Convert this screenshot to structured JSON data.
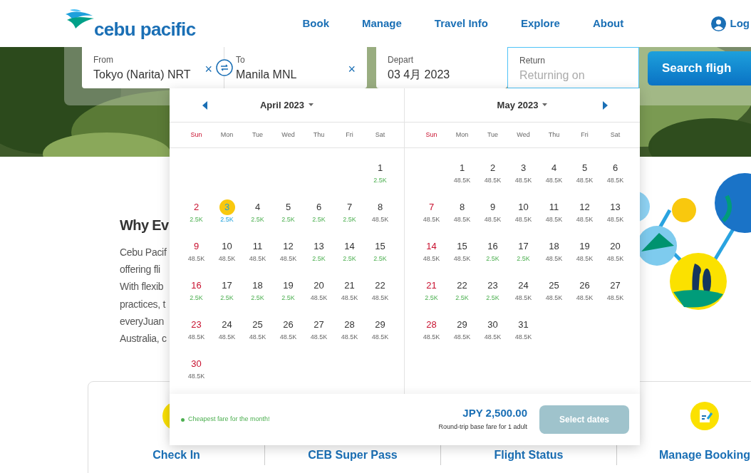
{
  "header": {
    "logo": "cebu pacific",
    "nav": [
      "Book",
      "Manage",
      "Travel Info",
      "Explore",
      "About"
    ],
    "login": "Log"
  },
  "search": {
    "from": {
      "label": "From",
      "value": "Tokyo (Narita) NRT",
      "clear": "×"
    },
    "to": {
      "label": "To",
      "value": "Manila MNL",
      "clear": "×"
    },
    "depart": {
      "label": "Depart",
      "value": "03 4月 2023"
    },
    "return": {
      "label": "Return",
      "placeholder": "Returning on"
    },
    "button": "Search fligh"
  },
  "why": {
    "heading": "Why Ev",
    "lines": [
      "Cebu Pacif",
      "offering fli",
      "With flexib",
      "practices, t",
      "everyJuan",
      "Australia, c"
    ]
  },
  "calendar": {
    "months": [
      {
        "title": "April 2023",
        "prev_arrow": true,
        "next_arrow": false,
        "weekdays": [
          "Sun",
          "Mon",
          "Tue",
          "Wed",
          "Thu",
          "Fri",
          "Sat"
        ],
        "days": [
          {
            "kind": "blank"
          },
          {
            "kind": "blank"
          },
          {
            "kind": "blank"
          },
          {
            "kind": "blank"
          },
          {
            "kind": "blank"
          },
          {
            "kind": "blank"
          },
          {
            "kind": "day",
            "day": "1",
            "fare": "2.5K",
            "cheapest": true,
            "selected": false
          },
          {
            "kind": "day",
            "day": "2",
            "fare": "2.5K",
            "cheapest": true,
            "selected": false
          },
          {
            "kind": "day",
            "day": "3",
            "fare": "2.5K",
            "selected": true
          },
          {
            "kind": "day",
            "day": "4",
            "fare": "2.5K",
            "cheapest": true,
            "selected": false
          },
          {
            "kind": "day",
            "day": "5",
            "fare": "2.5K",
            "cheapest": true,
            "selected": false
          },
          {
            "kind": "day",
            "day": "6",
            "fare": "2.5K",
            "cheapest": true,
            "selected": false
          },
          {
            "kind": "day",
            "day": "7",
            "fare": "2.5K",
            "cheapest": true,
            "selected": false
          },
          {
            "kind": "day",
            "day": "8",
            "fare": "48.5K",
            "cheapest": false,
            "selected": false
          },
          {
            "kind": "day",
            "day": "9",
            "fare": "48.5K",
            "cheapest": false,
            "selected": false
          },
          {
            "kind": "day",
            "day": "10",
            "fare": "48.5K",
            "cheapest": false,
            "selected": false
          },
          {
            "kind": "day",
            "day": "11",
            "fare": "48.5K",
            "cheapest": false,
            "selected": false
          },
          {
            "kind": "day",
            "day": "12",
            "fare": "48.5K",
            "cheapest": false,
            "selected": false
          },
          {
            "kind": "day",
            "day": "13",
            "fare": "2.5K",
            "cheapest": true,
            "selected": false
          },
          {
            "kind": "day",
            "day": "14",
            "fare": "2.5K",
            "cheapest": true,
            "selected": false
          },
          {
            "kind": "day",
            "day": "15",
            "fare": "2.5K",
            "cheapest": true,
            "selected": false
          },
          {
            "kind": "day",
            "day": "16",
            "fare": "2.5K",
            "cheapest": true,
            "selected": false
          },
          {
            "kind": "day",
            "day": "17",
            "fare": "2.5K",
            "cheapest": true,
            "selected": false
          },
          {
            "kind": "day",
            "day": "18",
            "fare": "2.5K",
            "cheapest": true,
            "selected": false
          },
          {
            "kind": "day",
            "day": "19",
            "fare": "2.5K",
            "cheapest": true,
            "selected": false
          },
          {
            "kind": "day",
            "day": "20",
            "fare": "48.5K",
            "cheapest": false,
            "selected": false
          },
          {
            "kind": "day",
            "day": "21",
            "fare": "48.5K",
            "cheapest": false,
            "selected": false
          },
          {
            "kind": "day",
            "day": "22",
            "fare": "48.5K",
            "cheapest": false,
            "selected": false
          },
          {
            "kind": "day",
            "day": "23",
            "fare": "48.5K",
            "cheapest": false,
            "selected": false
          },
          {
            "kind": "day",
            "day": "24",
            "fare": "48.5K",
            "cheapest": false,
            "selected": false
          },
          {
            "kind": "day",
            "day": "25",
            "fare": "48.5K",
            "cheapest": false,
            "selected": false
          },
          {
            "kind": "day",
            "day": "26",
            "fare": "48.5K",
            "cheapest": false,
            "selected": false
          },
          {
            "kind": "day",
            "day": "27",
            "fare": "48.5K",
            "cheapest": false,
            "selected": false
          },
          {
            "kind": "day",
            "day": "28",
            "fare": "48.5K",
            "cheapest": false,
            "selected": false
          },
          {
            "kind": "day",
            "day": "29",
            "fare": "48.5K",
            "cheapest": false,
            "selected": false
          },
          {
            "kind": "day",
            "day": "30",
            "fare": "48.5K",
            "cheapest": false,
            "selected": false
          }
        ]
      },
      {
        "title": "May 2023",
        "prev_arrow": false,
        "next_arrow": true,
        "weekdays": [
          "Sun",
          "Mon",
          "Tue",
          "Wed",
          "Thu",
          "Fri",
          "Sat"
        ],
        "days": [
          {
            "kind": "blank"
          },
          {
            "kind": "day",
            "day": "1",
            "fare": "48.5K",
            "cheapest": false,
            "selected": false
          },
          {
            "kind": "day",
            "day": "2",
            "fare": "48.5K",
            "cheapest": false,
            "selected": false
          },
          {
            "kind": "day",
            "day": "3",
            "fare": "48.5K",
            "cheapest": false,
            "selected": false
          },
          {
            "kind": "day",
            "day": "4",
            "fare": "48.5K",
            "cheapest": false,
            "selected": false
          },
          {
            "kind": "day",
            "day": "5",
            "fare": "48.5K",
            "cheapest": false,
            "selected": false
          },
          {
            "kind": "day",
            "day": "6",
            "fare": "48.5K",
            "cheapest": false,
            "selected": false
          },
          {
            "kind": "day",
            "day": "7",
            "fare": "48.5K",
            "cheapest": false,
            "selected": false
          },
          {
            "kind": "day",
            "day": "8",
            "fare": "48.5K",
            "cheapest": false,
            "selected": false
          },
          {
            "kind": "day",
            "day": "9",
            "fare": "48.5K",
            "cheapest": false,
            "selected": false
          },
          {
            "kind": "day",
            "day": "10",
            "fare": "48.5K",
            "cheapest": false,
            "selected": false
          },
          {
            "kind": "day",
            "day": "11",
            "fare": "48.5K",
            "cheapest": false,
            "selected": false
          },
          {
            "kind": "day",
            "day": "12",
            "fare": "48.5K",
            "cheapest": false,
            "selected": false
          },
          {
            "kind": "day",
            "day": "13",
            "fare": "48.5K",
            "cheapest": false,
            "selected": false
          },
          {
            "kind": "day",
            "day": "14",
            "fare": "48.5K",
            "cheapest": false,
            "selected": false
          },
          {
            "kind": "day",
            "day": "15",
            "fare": "48.5K",
            "cheapest": false,
            "selected": false
          },
          {
            "kind": "day",
            "day": "16",
            "fare": "2.5K",
            "cheapest": true,
            "selected": false
          },
          {
            "kind": "day",
            "day": "17",
            "fare": "2.5K",
            "cheapest": true,
            "selected": false
          },
          {
            "kind": "day",
            "day": "18",
            "fare": "48.5K",
            "cheapest": false,
            "selected": false
          },
          {
            "kind": "day",
            "day": "19",
            "fare": "48.5K",
            "cheapest": false,
            "selected": false
          },
          {
            "kind": "day",
            "day": "20",
            "fare": "48.5K",
            "cheapest": false,
            "selected": false
          },
          {
            "kind": "day",
            "day": "21",
            "fare": "2.5K",
            "cheapest": true,
            "selected": false
          },
          {
            "kind": "day",
            "day": "22",
            "fare": "2.5K",
            "cheapest": true,
            "selected": false
          },
          {
            "kind": "day",
            "day": "23",
            "fare": "2.5K",
            "cheapest": true,
            "selected": false
          },
          {
            "kind": "day",
            "day": "24",
            "fare": "48.5K",
            "cheapest": false,
            "selected": false
          },
          {
            "kind": "day",
            "day": "25",
            "fare": "48.5K",
            "cheapest": false,
            "selected": false
          },
          {
            "kind": "day",
            "day": "26",
            "fare": "48.5K",
            "cheapest": false,
            "selected": false
          },
          {
            "kind": "day",
            "day": "27",
            "fare": "48.5K",
            "cheapest": false,
            "selected": false
          },
          {
            "kind": "day",
            "day": "28",
            "fare": "48.5K",
            "cheapest": false,
            "selected": false
          },
          {
            "kind": "day",
            "day": "29",
            "fare": "48.5K",
            "cheapest": false,
            "selected": false
          },
          {
            "kind": "day",
            "day": "30",
            "fare": "48.5K",
            "cheapest": false,
            "selected": false
          },
          {
            "kind": "day",
            "day": "31",
            "fare": "48.5K",
            "cheapest": false,
            "selected": false
          }
        ]
      }
    ],
    "legend": "Cheapest fare for the month!",
    "price": "JPY 2,500.00",
    "price_note": "Round-trip base fare for 1 adult",
    "button": {
      "label": "Select dates",
      "disabled": true
    }
  },
  "services": [
    {
      "label": "Check In",
      "icon_shown": true
    },
    {
      "label": "CEB Super Pass"
    },
    {
      "label": "Flight Status"
    },
    {
      "label": "Manage Booking",
      "icon_shown": true
    }
  ]
}
